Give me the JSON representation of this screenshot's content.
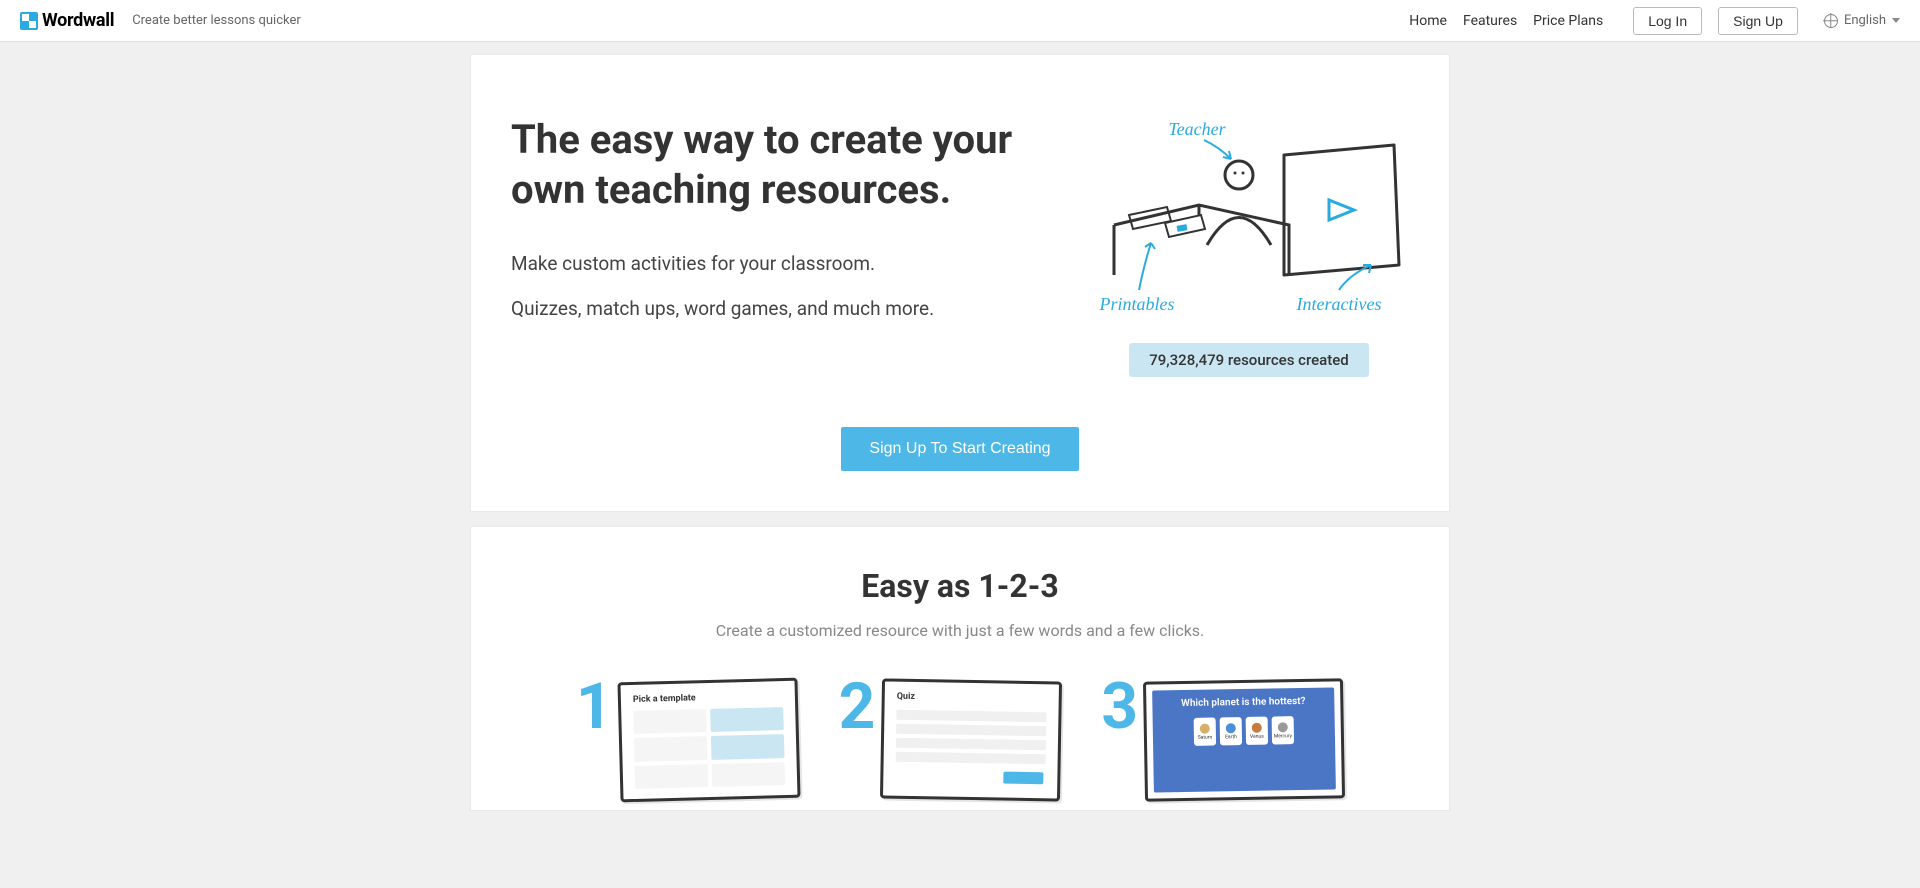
{
  "brand": {
    "name": "Wordwall",
    "tagline": "Create better lessons quicker"
  },
  "nav": {
    "home": "Home",
    "features": "Features",
    "pricing": "Price Plans",
    "login": "Log In",
    "signup": "Sign Up",
    "language": "English"
  },
  "hero": {
    "title": "The easy way to create your own teaching resources.",
    "line1": "Make custom activities for your classroom.",
    "line2": "Quizzes, match ups, word games, and much more.",
    "badge": "79,328,479 resources created",
    "cta": "Sign Up To Start Creating",
    "illustration_labels": {
      "teacher": "Teacher",
      "printables": "Printables",
      "interactives": "Interactives"
    }
  },
  "section_easy": {
    "title": "Easy as 1-2-3",
    "subtitle": "Create a customized resource with just a few words and a few clicks.",
    "steps": {
      "s1": {
        "num": "1",
        "label": "Pick a template"
      },
      "s2": {
        "num": "2",
        "label": "Quiz"
      },
      "s3": {
        "num": "3",
        "question": "Which planet is the hottest?",
        "planets": [
          "Saturn",
          "Earth",
          "Venus",
          "Mercury"
        ]
      }
    }
  }
}
